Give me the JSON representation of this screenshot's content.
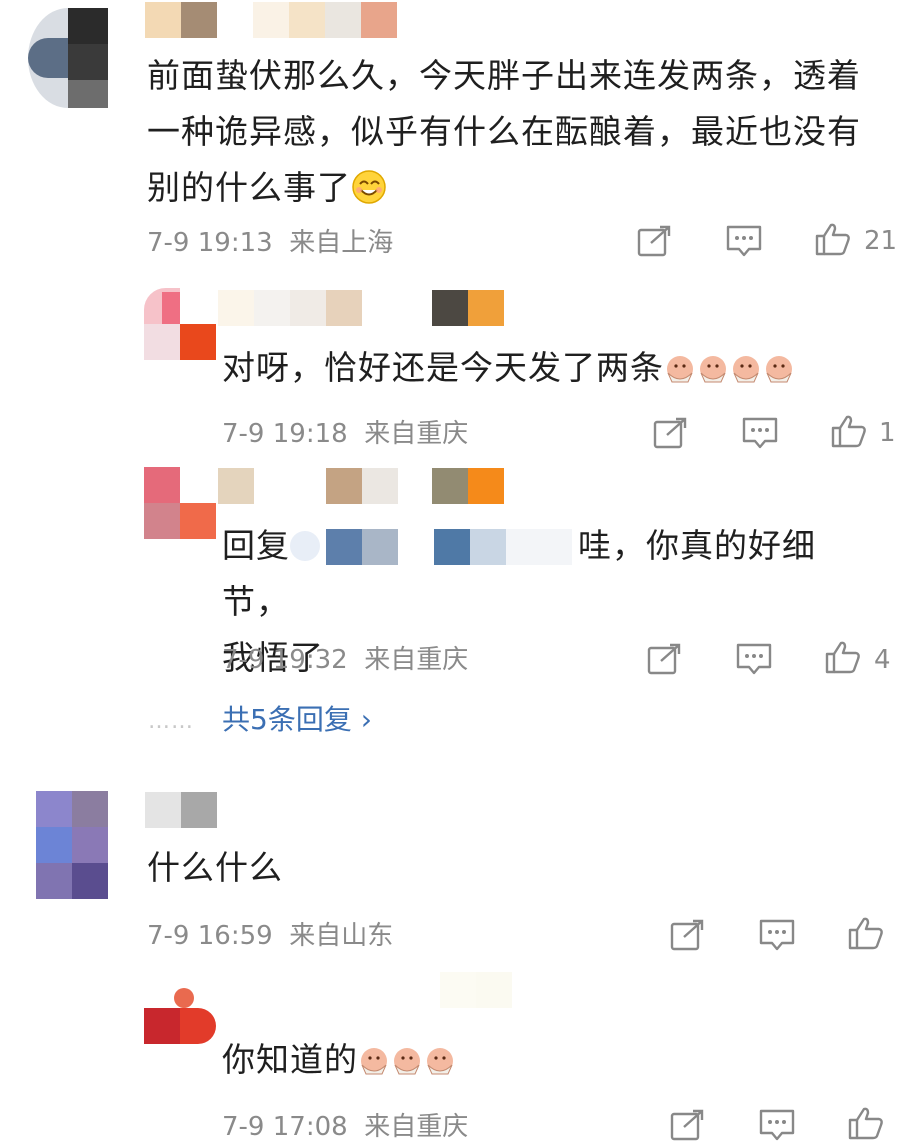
{
  "comments": [
    {
      "text": "前面蛰伏那么久，今天胖子出来连发两条，透着一种诡异感，似乎有什么在酝酿着，最近也没有别的什么事了",
      "time": "7-9 19:13",
      "location": "来自上海",
      "likes": "21",
      "emoji": "smiling-face-emoji"
    },
    {
      "text": "对呀，恰好还是今天发了两条",
      "time": "7-9 19:18",
      "location": "来自重庆",
      "likes": "1",
      "emoji": "cheering-doge-emoji"
    },
    {
      "text_prefix": "回复",
      "text_line1_suffix": "哇，你真的好细节，",
      "text_line2": "我悟了",
      "time": "7-9 19:32",
      "location": "来自重庆",
      "likes": "4"
    },
    {
      "text": "什么什么",
      "time": "7-9 16:59",
      "location": "来自山东",
      "likes": ""
    },
    {
      "text": "你知道的",
      "time": "7-9 17:08",
      "location": "来自重庆",
      "likes": "",
      "emoji": "cheering-doge-emoji"
    }
  ],
  "thread": {
    "dots": "……",
    "more_replies": "共5条回复",
    "more_chevron": "›"
  },
  "icons": {
    "share": "share-icon",
    "reply": "comment-icon",
    "like": "thumbs-up-icon"
  },
  "colors": {
    "text": "#1f1f1f",
    "meta": "#8a8a8a",
    "link": "#3b6fb3",
    "icon": "#888888"
  }
}
